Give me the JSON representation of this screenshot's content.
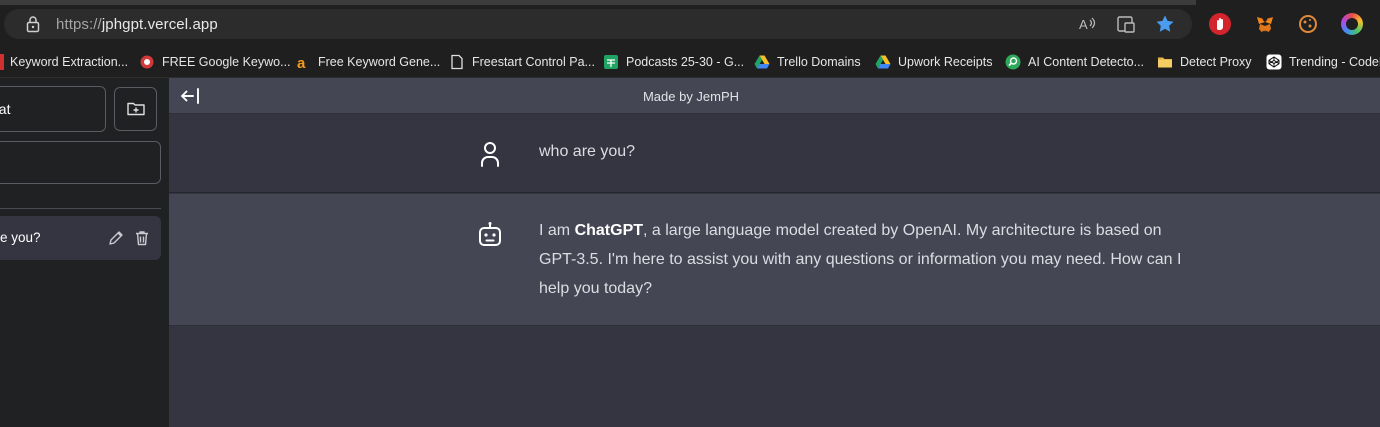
{
  "browser": {
    "url_scheme": "https://",
    "url_host": "jphgpt.vercel.app"
  },
  "bookmarks": [
    {
      "label": "Keyword Extraction...",
      "icon": "bookmark-icon"
    },
    {
      "label": "FREE Google Keywo...",
      "icon": "google-keyword-icon"
    },
    {
      "label": "Free Keyword Gene...",
      "icon": "keyword-generator-icon"
    },
    {
      "label": "Freestart Control Pa...",
      "icon": "page-icon"
    },
    {
      "label": "Podcasts 25-30 - G...",
      "icon": "sheets-icon"
    },
    {
      "label": "Trello Domains",
      "icon": "drive-icon"
    },
    {
      "label": "Upwork Receipts",
      "icon": "drive-icon"
    },
    {
      "label": "AI Content Detecto...",
      "icon": "detector-icon"
    },
    {
      "label": "Detect Proxy",
      "icon": "folder-icon"
    },
    {
      "label": "Trending - CodeP",
      "icon": "codepen-icon"
    }
  ],
  "sidebar": {
    "new_chat_label": "hat",
    "conversation_label": "e you?"
  },
  "header": {
    "title": "Made by JemPH"
  },
  "messages": {
    "user_text": "who are you?",
    "bot_intro": "I am ",
    "bot_bold": "ChatGPT",
    "bot_rest": ", a large language model created by OpenAI. My architecture is based on GPT-3.5. I'm here to assist you with any questions or information you may need. How can I help you today?"
  },
  "colors": {
    "accent_star": "#4a9cf0",
    "main_bg": "#343541",
    "bot_bg": "#444654",
    "sidebar_bg": "#202123"
  }
}
